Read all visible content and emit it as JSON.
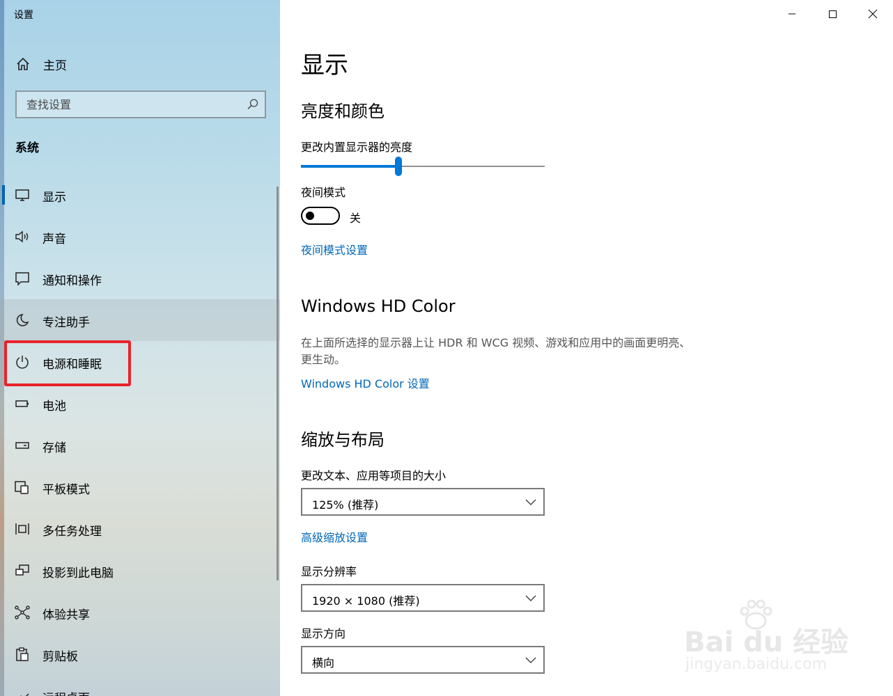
{
  "window": {
    "title": "设置",
    "controls": {
      "minimize": "minimize",
      "maximize": "maximize",
      "close": "close"
    }
  },
  "sidebar": {
    "home_label": "主页",
    "search_placeholder": "查找设置",
    "section_label": "系统",
    "items": [
      {
        "label": "显示",
        "icon": "monitor-icon",
        "selected": true
      },
      {
        "label": "声音",
        "icon": "speaker-icon"
      },
      {
        "label": "通知和操作",
        "icon": "notification-icon"
      },
      {
        "label": "专注助手",
        "icon": "moon-icon",
        "hover": true
      },
      {
        "label": "电源和睡眠",
        "icon": "power-icon",
        "highlighted": true
      },
      {
        "label": "电池",
        "icon": "battery-icon"
      },
      {
        "label": "存储",
        "icon": "storage-icon"
      },
      {
        "label": "平板模式",
        "icon": "tablet-mode-icon"
      },
      {
        "label": "多任务处理",
        "icon": "multitasking-icon"
      },
      {
        "label": "投影到此电脑",
        "icon": "project-icon"
      },
      {
        "label": "体验共享",
        "icon": "shared-experiences-icon"
      },
      {
        "label": "剪贴板",
        "icon": "clipboard-icon"
      },
      {
        "label": "远程桌面",
        "icon": "remote-desktop-icon"
      }
    ],
    "highlight_color": "#e8232a"
  },
  "content": {
    "page_title": "显示",
    "brightness_section": {
      "heading": "亮度和颜色",
      "slider_label": "更改内置显示器的亮度",
      "brightness_value": 0.4,
      "night_light_label": "夜间模式",
      "night_light_state": "关",
      "night_light_settings_link": "夜间模式设置"
    },
    "hdr_section": {
      "heading": "Windows HD Color",
      "description": "在上面所选择的显示器上让 HDR 和 WCG 视频、游戏和应用中的画面更明亮、更生动。",
      "link": "Windows HD Color 设置"
    },
    "scale_section": {
      "heading": "缩放与布局",
      "scale_label": "更改文本、应用等项目的大小",
      "scale_value": "125% (推荐)",
      "advanced_link": "高级缩放设置",
      "resolution_label": "显示分辨率",
      "resolution_value": "1920 × 1080 (推荐)",
      "orientation_label": "显示方向",
      "orientation_value": "横向"
    },
    "accent_color": "#0078d7",
    "link_color": "#0067b8"
  },
  "watermark": {
    "brand": "Bai du 经验",
    "url": "jingyan.baidu.com"
  }
}
